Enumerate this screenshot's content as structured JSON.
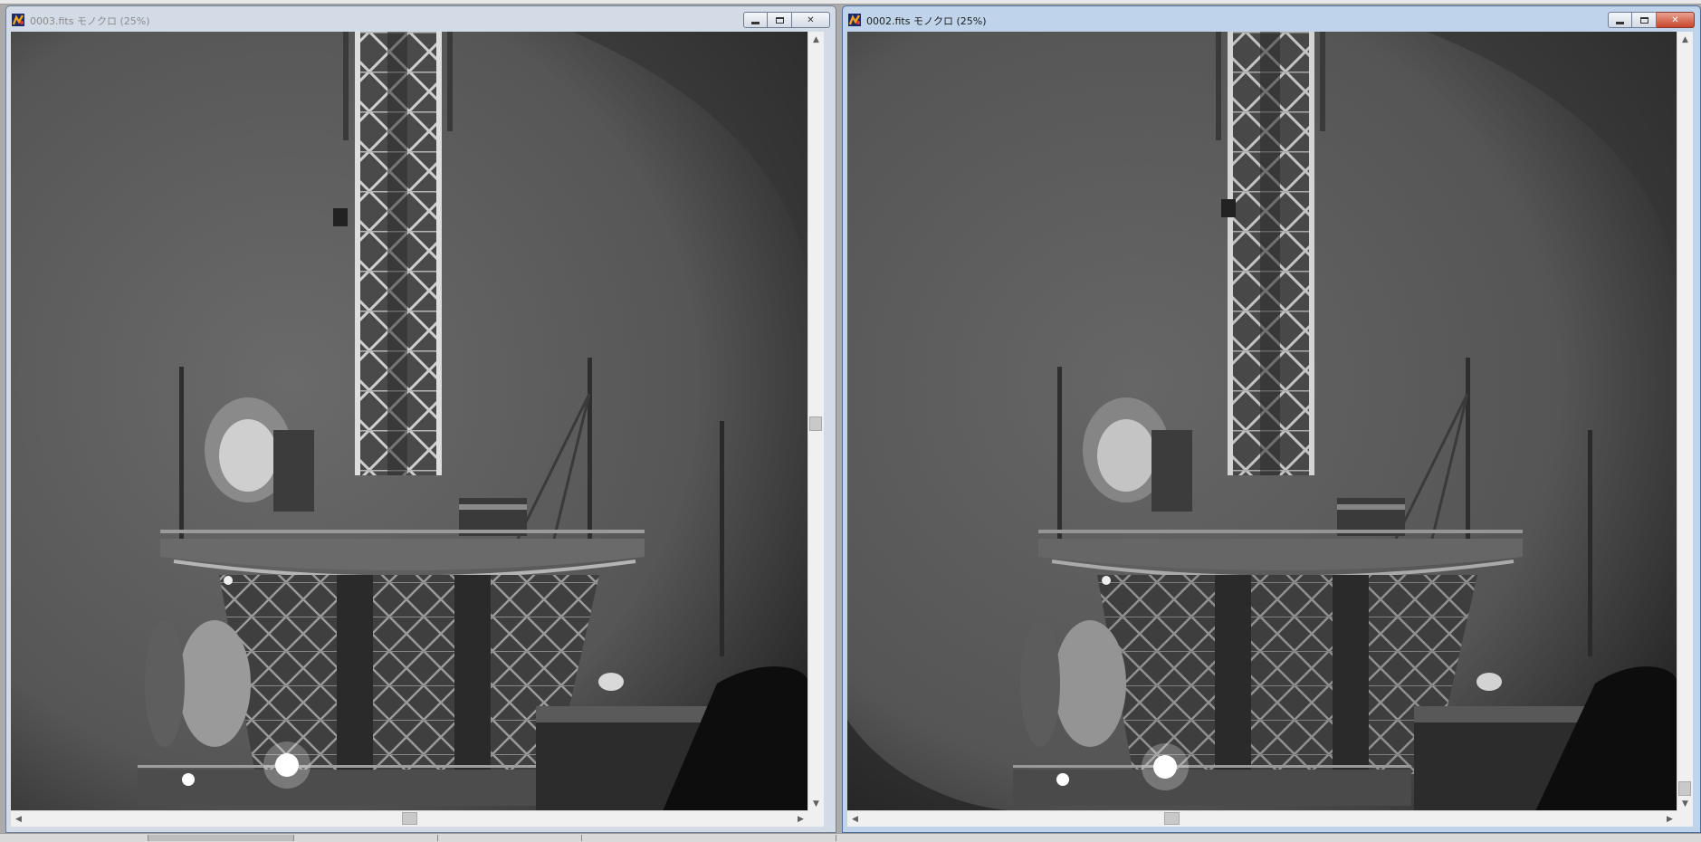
{
  "windows": [
    {
      "title": "0003.fits モノクロ (25%)",
      "active": false
    },
    {
      "title": "0002.fits モノクロ (25%)",
      "active": true
    }
  ],
  "controls": {
    "minimize_icon": "minimize-icon",
    "maximize_icon": "restore-icon",
    "close_icon": "close-icon",
    "close_glyph": "✕"
  },
  "scroll": {
    "up": "▲",
    "down": "▼",
    "left": "◀",
    "right": "▶"
  },
  "colors": {
    "sky": "#5b5b5b",
    "structure": "#c8c8c8",
    "active_frame": "#bfd3ea",
    "inactive_frame": "#d3dbe7"
  }
}
